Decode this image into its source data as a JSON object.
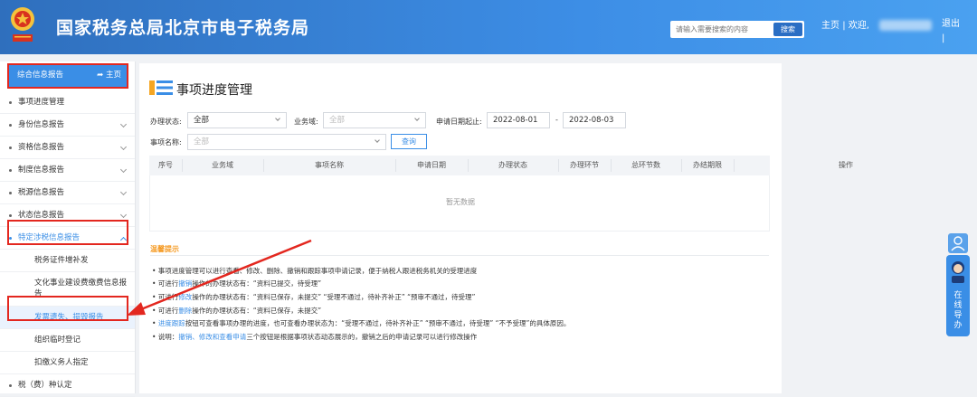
{
  "header": {
    "title": "国家税务总局北京市电子税务局",
    "search_placeholder": "请输入需要搜索的内容",
    "search_button": "搜索",
    "home_link": "主页",
    "welcome": "| 欢迎,",
    "logout": "退出",
    "logout_sep": "|"
  },
  "sidebar": {
    "head_label": "综合信息报告",
    "head_home": "主页",
    "items": [
      {
        "label": "事项进度管理"
      },
      {
        "label": "身份信息报告"
      },
      {
        "label": "资格信息报告"
      },
      {
        "label": "制度信息报告"
      },
      {
        "label": "税源信息报告"
      },
      {
        "label": "状态信息报告"
      },
      {
        "label": "特定涉税信息报告"
      },
      {
        "label": "税务证件增补发"
      },
      {
        "label": "文化事业建设费缴费信息报告"
      },
      {
        "label": "发票遗失、损毁报告"
      },
      {
        "label": "组织临时登记"
      },
      {
        "label": "扣缴义务人指定"
      },
      {
        "label": "税（费）种认定"
      }
    ]
  },
  "main": {
    "page_title": "事项进度管理",
    "filters": {
      "status_label": "办理状态:",
      "status_value": "全部",
      "domain_label": "业务域:",
      "domain_value": "全部",
      "date_label": "申请日期起止:",
      "date_from": "2022-08-01",
      "date_sep": "-",
      "date_to": "2022-08-03",
      "name_label": "事项名称:",
      "name_value": "全部",
      "query_button": "查询"
    },
    "table": {
      "columns": [
        "序号",
        "业务域",
        "事项名称",
        "申请日期",
        "办理状态",
        "办理环节",
        "总环节数",
        "办结期限",
        "操作"
      ],
      "empty_text": "暂无数据"
    },
    "tips": {
      "title": "温馨提示",
      "lines": [
        {
          "pre": "• 事项进度管理可以进行查看、修改、删除、撤销和跟踪事项申请记录，便于纳税人跟进税务机关的受理进度",
          "b1": "",
          "post": ""
        },
        {
          "pre": "• 可进行",
          "b1": "撤销",
          "post": "操作的办理状态有：“资料已提交，待受理”"
        },
        {
          "pre": "• 可进行",
          "b1": "修改",
          "post": "操作的办理状态有：“资料已保存，未提交”  “受理不通过，待补齐补正”  “预审不通过，待受理”"
        },
        {
          "pre": "• 可进行",
          "b1": "删除",
          "post": "操作的办理状态有：“资料已保存，未提交”"
        },
        {
          "pre": "• ",
          "b1": "进度跟踪",
          "post": "按钮可查看事项办理的进度，也可查看办理状态为：“受理不通过，待补齐补正”  “预审不通过，待受理”  “不予受理”的具体原因。"
        },
        {
          "pre": "• 说明：",
          "b1": "撤销、修改和查看申请",
          "post": "三个按钮是根据事项状态动态展示的，撤销之后的申请记录可以进行修改操作"
        }
      ]
    }
  },
  "float_widget": {
    "text": "在线导办"
  },
  "colors": {
    "accent": "#3a8ee6",
    "header": "#3d8ee6",
    "highlight_red": "#e3271f",
    "tips_orange": "#f59a23"
  }
}
